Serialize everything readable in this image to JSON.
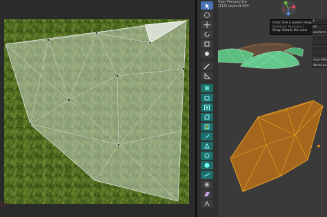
{
  "viewport": {
    "title": "User Perspective",
    "object_label": "(115) object1.004",
    "tooltip": {
      "line1": "Click: Use a preset viewpoint",
      "line2": "Shortcut: Numpad 1",
      "line3": "Drag: Rotate the view"
    },
    "n_panel": [
      "t",
      "cti",
      "ansform",
      "",
      "",
      "",
      "",
      "Auto Mer",
      "Workspace"
    ]
  },
  "toolbar": {
    "icons": [
      "select-cursor-icon",
      "cursor-icon",
      "move-icon",
      "rotate-icon",
      "scale-icon",
      "transform-icon",
      "annotate-icon",
      "measure-icon",
      "add-cube-icon",
      "extrude-icon",
      "inset-icon",
      "bevel-icon",
      "loop-cut-icon",
      "knife-icon",
      "poly-build-icon",
      "spin-icon",
      "smooth-icon",
      "edge-slide-icon",
      "shrink-fatten-icon",
      "shear-icon",
      "rip-icon"
    ]
  },
  "colors": {
    "uv_mesh_fill": "#a7b3a3",
    "selected_mesh": "#e89a1e",
    "viewport_bg": "#3a3a3a",
    "active_tool": "#4772b3"
  }
}
